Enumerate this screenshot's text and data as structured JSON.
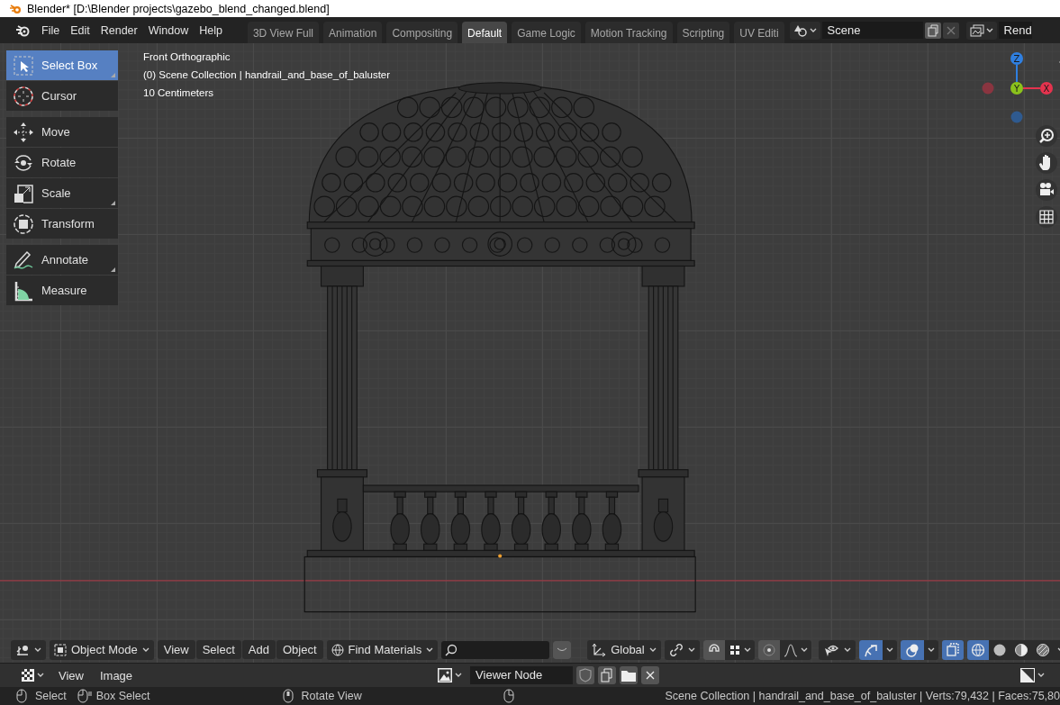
{
  "window": {
    "title": "Blender* [D:\\Blender projects\\gazebo_blend_changed.blend]"
  },
  "menus": [
    "File",
    "Edit",
    "Render",
    "Window",
    "Help"
  ],
  "workspaces": [
    {
      "label": "3D View Full",
      "selected": false
    },
    {
      "label": "Animation",
      "selected": false
    },
    {
      "label": "Compositing",
      "selected": false
    },
    {
      "label": "Default",
      "selected": true
    },
    {
      "label": "Game Logic",
      "selected": false
    },
    {
      "label": "Motion Tracking",
      "selected": false
    },
    {
      "label": "Scripting",
      "selected": false
    },
    {
      "label": "UV Editi",
      "selected": false
    }
  ],
  "scene": {
    "name": "Scene"
  },
  "view_layer": {
    "name": "Rend"
  },
  "toolbar": {
    "groups": [
      [
        {
          "kind": "select",
          "label": "Select Box",
          "selected": true,
          "has_options": true
        },
        {
          "kind": "cursor",
          "label": "Cursor",
          "selected": false,
          "has_options": false
        }
      ],
      [
        {
          "kind": "move",
          "label": "Move",
          "selected": false,
          "has_options": false
        },
        {
          "kind": "rotate",
          "label": "Rotate",
          "selected": false,
          "has_options": false
        },
        {
          "kind": "scale",
          "label": "Scale",
          "selected": false,
          "has_options": true
        },
        {
          "kind": "transform",
          "label": "Transform",
          "selected": false,
          "has_options": false
        }
      ],
      [
        {
          "kind": "annotate",
          "label": "Annotate",
          "selected": false,
          "has_options": true
        },
        {
          "kind": "measure",
          "label": "Measure",
          "selected": false,
          "has_options": false
        }
      ]
    ]
  },
  "overlay_text": [
    "Front Orthographic",
    "(0) Scene Collection | handrail_and_base_of_baluster",
    "10 Centimeters"
  ],
  "nav_gizmo": {
    "axes": [
      {
        "label": "Z",
        "color": "#2f7fe0"
      },
      {
        "label": "Y",
        "color": "#8bc21c"
      },
      {
        "label": "X",
        "color": "#e5334e"
      }
    ]
  },
  "viewport_header": {
    "mode": "Object Mode",
    "menus": [
      "View",
      "Select",
      "Add",
      "Object"
    ],
    "material_search": "Find Materials",
    "orientation": "Global",
    "snap": false,
    "proportional_editing": false,
    "gizmos": true,
    "overlays": true,
    "xray": true,
    "shading": [
      {
        "kind": "wireframe",
        "selected": true
      },
      {
        "kind": "solid",
        "selected": false
      },
      {
        "kind": "material",
        "selected": false
      },
      {
        "kind": "rendered",
        "selected": false
      }
    ]
  },
  "image_editor_header": {
    "menus": [
      "View",
      "Image"
    ],
    "image": "Viewer Node"
  },
  "status_bar": {
    "hints": [
      {
        "kind": "left",
        "label": "Select"
      },
      {
        "kind": "drag",
        "label": "Box Select"
      },
      {
        "kind": "middle",
        "label": "Rotate View"
      }
    ],
    "stats": "Scene Collection | handrail_and_base_of_baluster | Verts:79,432 | Faces:75,80"
  }
}
